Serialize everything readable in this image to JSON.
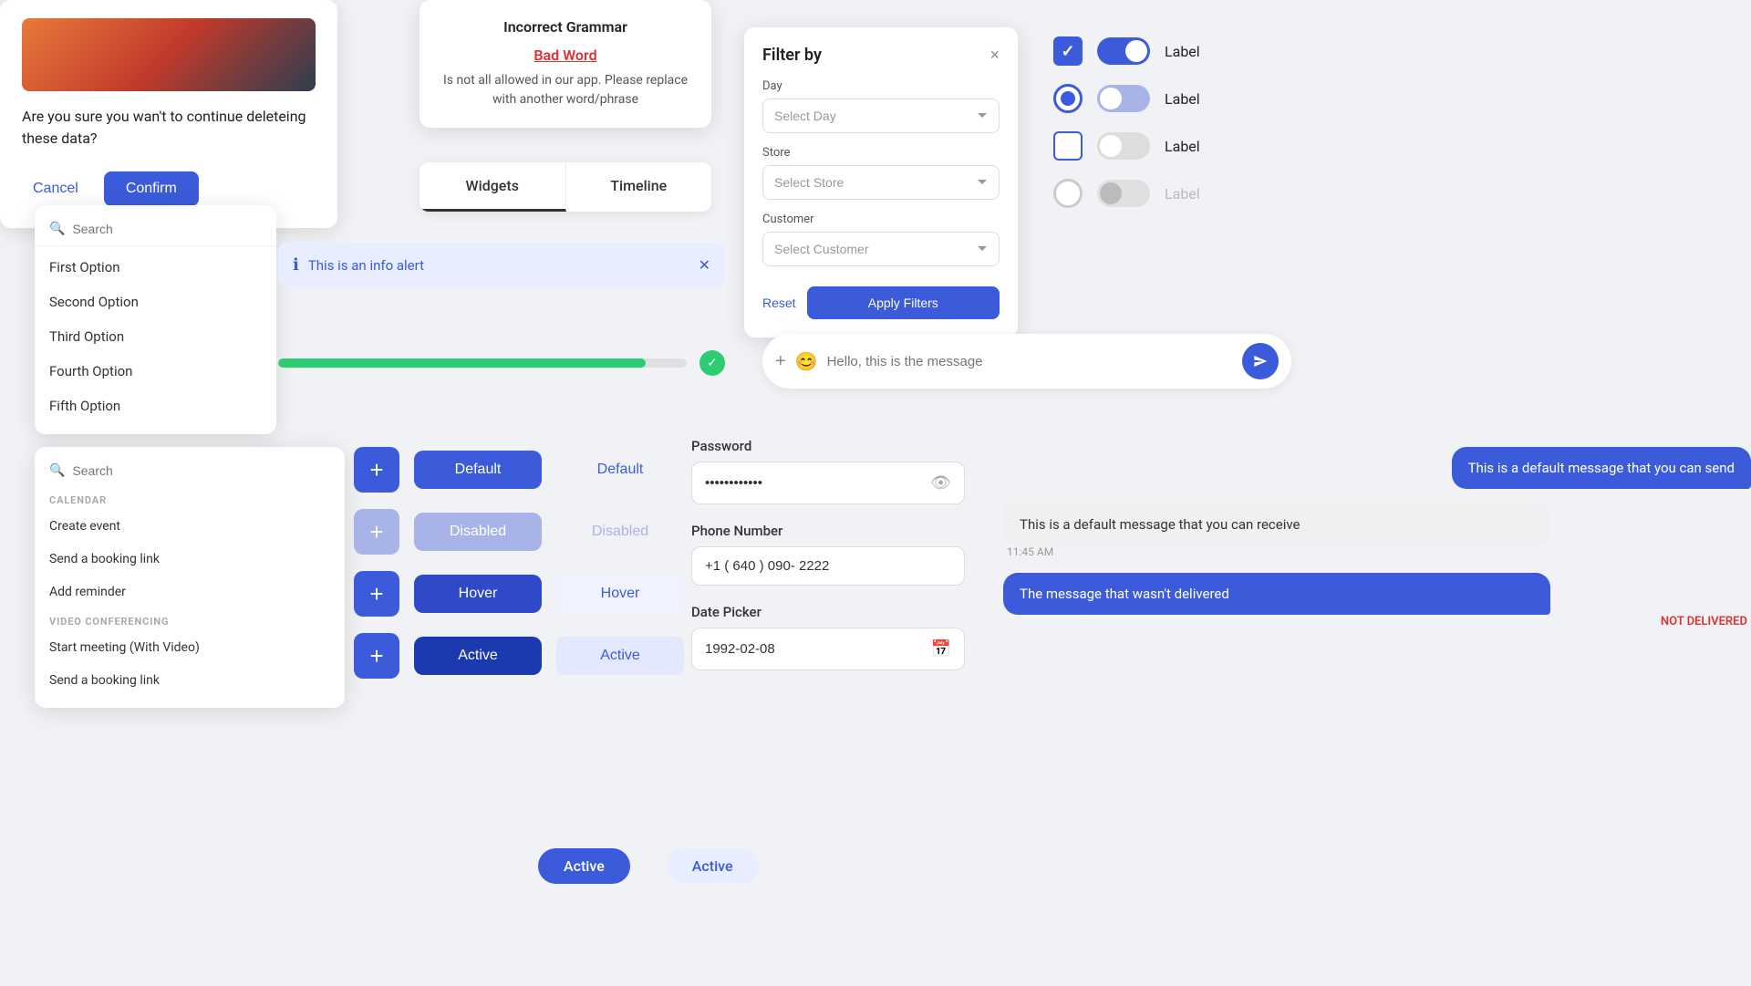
{
  "confirm_dialog": {
    "body_text": "Are you sure you wan't to continue deleteing these data?",
    "cancel_label": "Cancel",
    "confirm_label": "Confirm"
  },
  "grammar_modal": {
    "title": "Incorrect Grammar",
    "bad_word": "Bad Word",
    "description": "Is not all allowed in our app. Please replace with another word/phrase"
  },
  "filter_panel": {
    "title": "Filter by",
    "close_label": "×",
    "day_label": "Day",
    "day_placeholder": "Select Day",
    "store_label": "Store",
    "store_placeholder": "Select Store",
    "customer_label": "Customer",
    "customer_placeholder": "Select Customer",
    "reset_label": "Reset",
    "apply_label": "Apply Filters"
  },
  "controls": {
    "label": "Label",
    "checkbox_checked": true,
    "radio_checked": true,
    "checkbox_unchecked": false,
    "radio_unchecked": false
  },
  "dropdown1": {
    "search_placeholder": "Search",
    "items": [
      "First Option",
      "Second Option",
      "Third Option",
      "Fourth Option",
      "Fifth Option"
    ]
  },
  "info_alert": {
    "text": "This is an info alert"
  },
  "tabs": {
    "items": [
      "Widgets",
      "Timeline"
    ]
  },
  "progress": {
    "percent": 90,
    "complete": true
  },
  "message_input": {
    "placeholder": "Hello, this is the message"
  },
  "dropdown2": {
    "search_placeholder": "Search",
    "sections": [
      {
        "label": "CALENDAR",
        "items": [
          "Create event",
          "Send a booking link",
          "Add reminder"
        ]
      },
      {
        "label": "VIDEO CONFERENCING",
        "items": [
          "Start meeting (With Video)",
          "Send a booking link"
        ]
      }
    ]
  },
  "buttons": {
    "default_label": "Default",
    "disabled_label": "Disabled",
    "hover_label": "Hover",
    "active_label": "Active",
    "ghost_default": "Default",
    "ghost_disabled": "Disabled",
    "ghost_hover": "Hover",
    "ghost_active": "Active"
  },
  "form_fields": {
    "password_label": "Password",
    "password_value": "••••••••••••",
    "phone_label": "Phone Number",
    "phone_value": "+1 ( 640 ) 090- 2222",
    "date_label": "Date Picker",
    "date_value": "1992-02-08"
  },
  "chat": {
    "sent_msg": "This is a default message that you can send",
    "received_msg": "This is a default message that you can receive",
    "received_time": "11:45 AM",
    "failed_msg": "The message that wasn't delivered",
    "failed_status": "NOT DELIVERED"
  },
  "status_badges": {
    "active1": "Active",
    "active2": "Active"
  }
}
